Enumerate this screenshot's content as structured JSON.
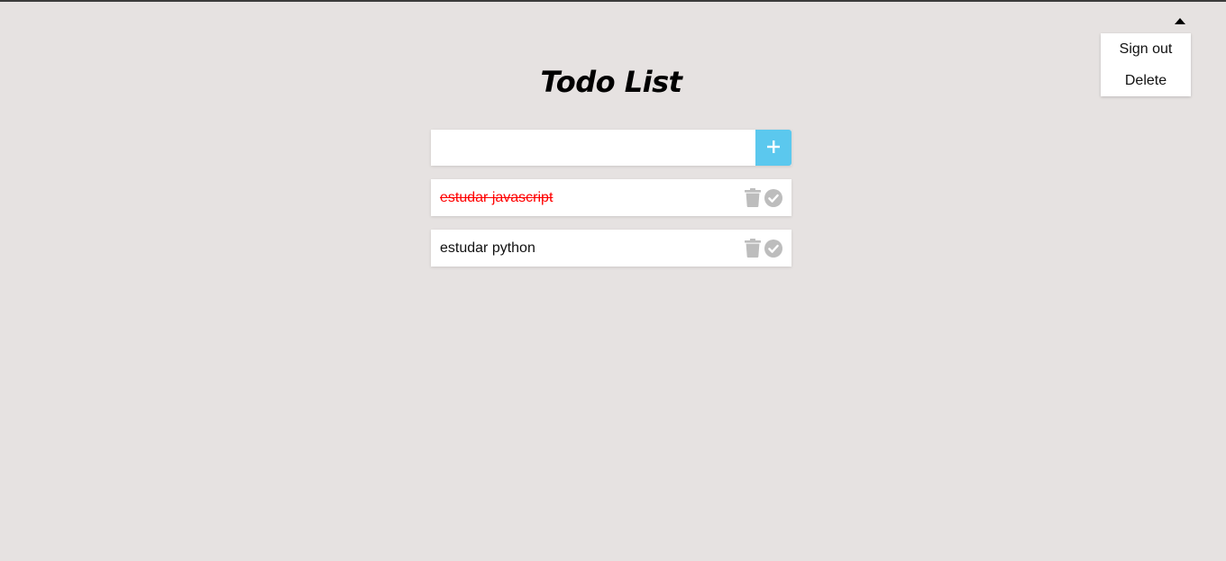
{
  "header": {
    "menu_toggle_icon": "caret-up-icon"
  },
  "menu": {
    "items": [
      {
        "label": "Sign out"
      },
      {
        "label": "Delete"
      }
    ]
  },
  "app": {
    "title": "Todo List"
  },
  "new_todo": {
    "value": "",
    "placeholder": "",
    "add_icon": "plus-icon",
    "add_color": "#5bc8ee"
  },
  "todos": [
    {
      "text": "estudar javascript",
      "completed": true,
      "delete_icon": "trash-icon",
      "complete_icon": "check-circle-icon"
    },
    {
      "text": "estudar python",
      "completed": false,
      "delete_icon": "trash-icon",
      "complete_icon": "check-circle-icon"
    }
  ],
  "colors": {
    "background": "#e6e2e1",
    "completed_text": "#ff0000",
    "icon_gray": "#bdbdbd"
  }
}
